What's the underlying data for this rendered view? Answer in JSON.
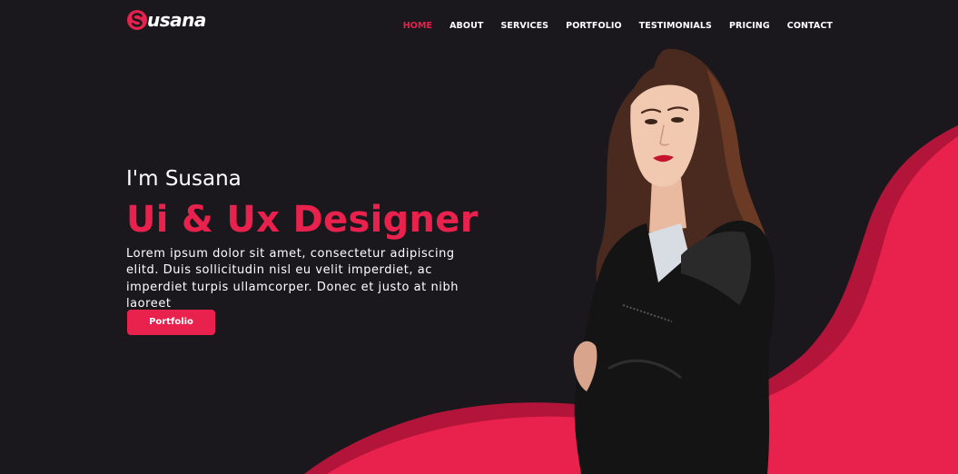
{
  "brand": {
    "name": "usana",
    "logo_letter": "S",
    "accent_color": "#e8214d",
    "dark_accent_color": "#b3153a",
    "background_color": "#1a181d"
  },
  "nav": {
    "items": [
      {
        "label": "HOME",
        "active": true
      },
      {
        "label": "ABOUT",
        "active": false
      },
      {
        "label": "SERVICES",
        "active": false
      },
      {
        "label": "PORTFOLIO",
        "active": false
      },
      {
        "label": "TESTIMONIALS",
        "active": false
      },
      {
        "label": "PRICING",
        "active": false
      },
      {
        "label": "CONTACT",
        "active": false
      }
    ]
  },
  "hero": {
    "intro": "I'm Susana",
    "title": "Ui & Ux Designer",
    "description": "Lorem ipsum dolor sit amet, consectetur adipiscing elitd. Duis sollicitudin nisl eu velit imperdiet, ac imperdiet turpis ullamcorper. Donec et justo at nibh laoreet",
    "button_label": "Portfolio"
  },
  "portrait": {
    "icon": "woman-portrait-icon"
  }
}
